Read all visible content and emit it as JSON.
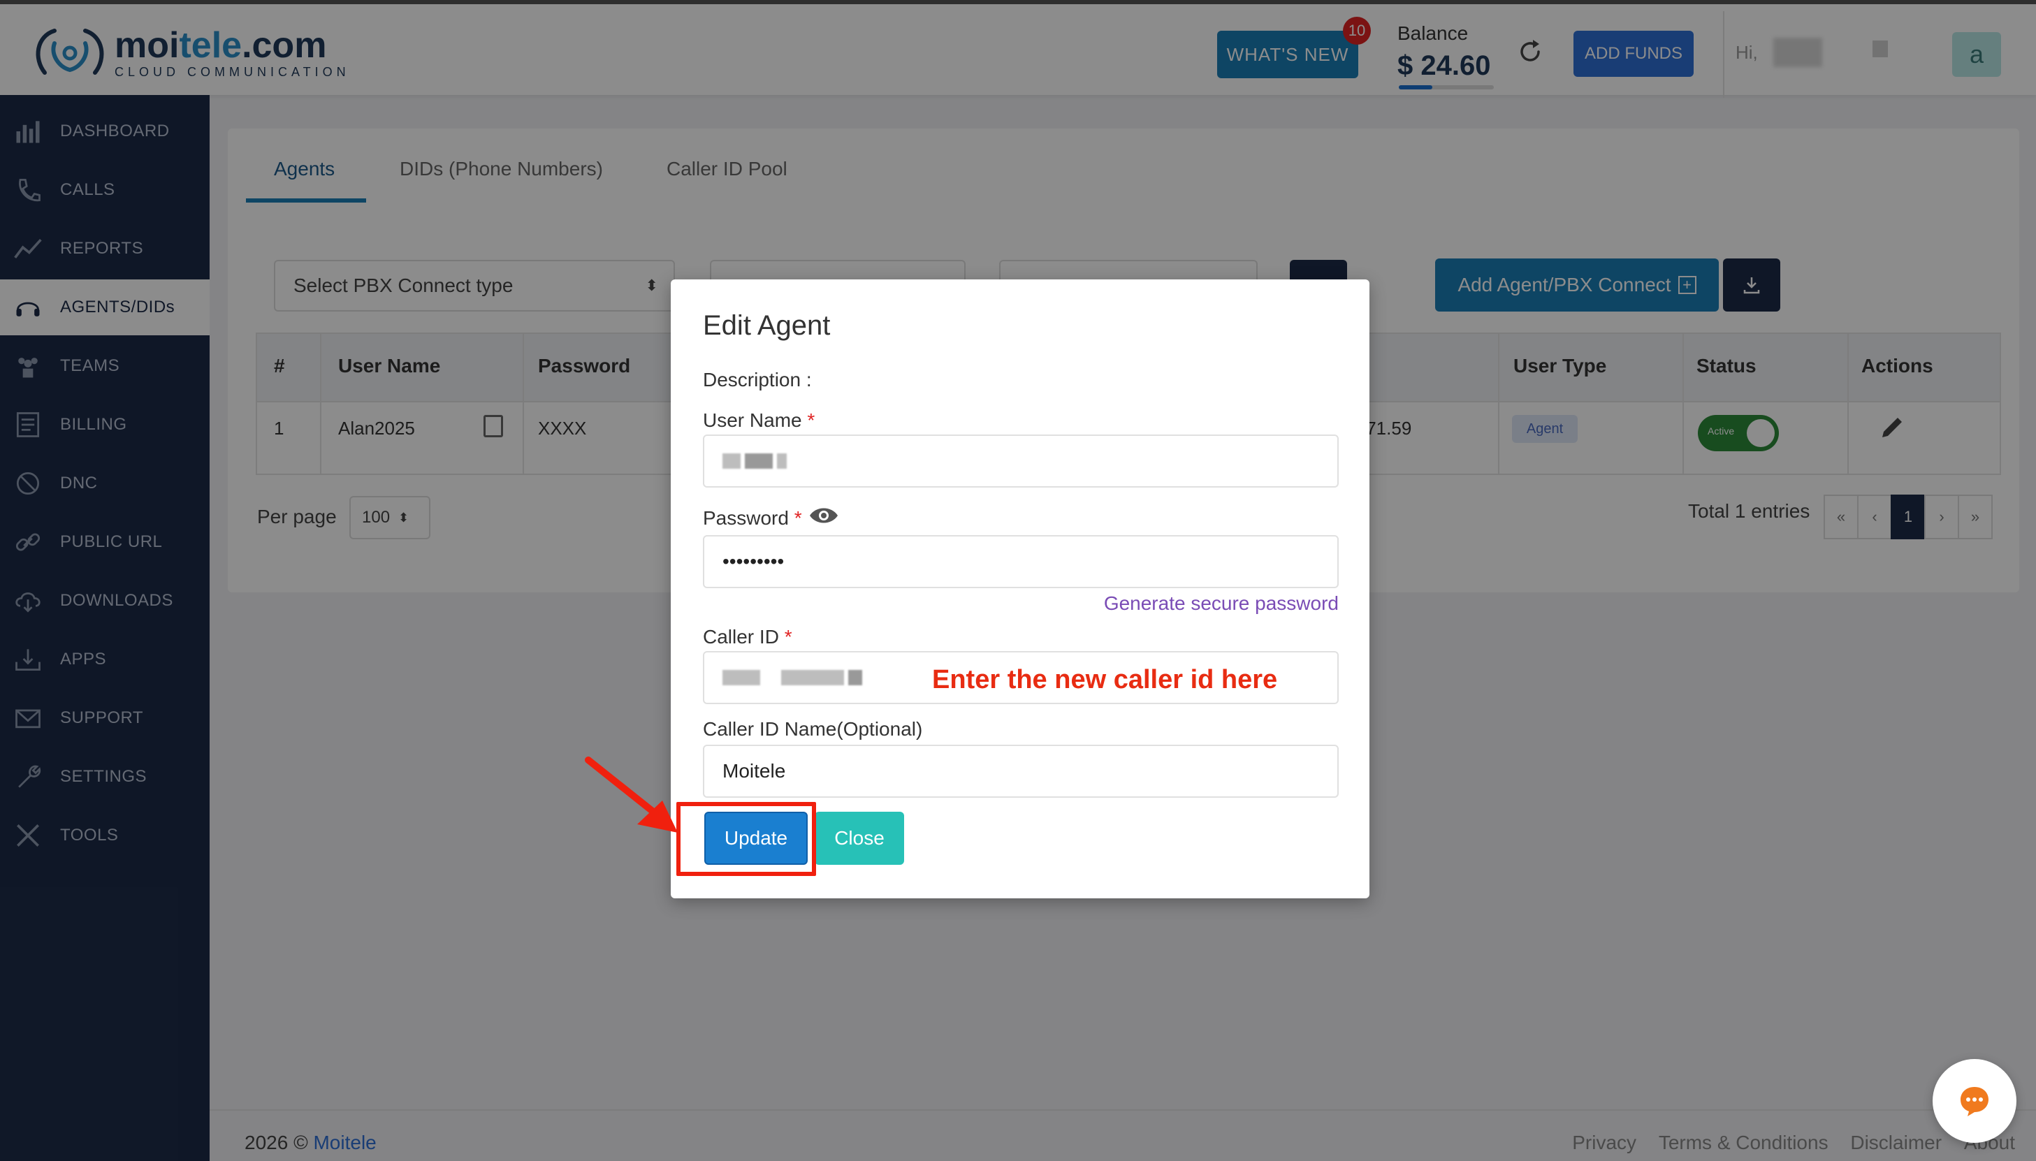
{
  "brand": {
    "name_prefix": "moi",
    "name_accent": "tele",
    "name_suffix": ".com",
    "tagline": "CLOUD COMMUNICATION"
  },
  "header": {
    "whats_new": "WHAT'S NEW",
    "whats_new_count": "10",
    "balance_label": "Balance",
    "balance_value": "$ 24.60",
    "add_funds": "ADD FUNDS",
    "greeting": "Hi,",
    "avatar_letter": "a"
  },
  "sidebar": {
    "items": [
      {
        "label": "DASHBOARD",
        "icon": "chart-bars-icon"
      },
      {
        "label": "CALLS",
        "icon": "phone-icon"
      },
      {
        "label": "REPORTS",
        "icon": "trend-line-icon"
      },
      {
        "label": "AGENTS/DIDs",
        "icon": "headset-icon",
        "active": true
      },
      {
        "label": "TEAMS",
        "icon": "team-icon"
      },
      {
        "label": "BILLING",
        "icon": "invoice-icon"
      },
      {
        "label": "DNC",
        "icon": "ban-icon"
      },
      {
        "label": "PUBLIC URL",
        "icon": "link-icon"
      },
      {
        "label": "DOWNLOADS",
        "icon": "cloud-download-icon"
      },
      {
        "label": "APPS",
        "icon": "tray-download-icon"
      },
      {
        "label": "SUPPORT",
        "icon": "mail-icon"
      },
      {
        "label": "SETTINGS",
        "icon": "wrench-icon"
      },
      {
        "label": "TOOLS",
        "icon": "tools-icon"
      }
    ]
  },
  "tabs": [
    "Agents",
    "DIDs (Phone Numbers)",
    "Caller ID Pool"
  ],
  "filters": {
    "pbx_type_placeholder": "Select PBX Connect type",
    "add_agent": "Add Agent/PBX Connect"
  },
  "table": {
    "headers": [
      "#",
      "User Name",
      "Password",
      "User Type",
      "Status",
      "Actions"
    ],
    "row": {
      "num": "1",
      "username": "Alan2025",
      "password": "XXXX",
      "ip_tail": ".71.59",
      "user_type": "Agent",
      "status": "Active"
    }
  },
  "pagination": {
    "per_page_label": "Per page",
    "per_page_value": "100",
    "total": "Total 1 entries",
    "first": "«",
    "prev": "‹",
    "current": "1",
    "next": "›",
    "last": "»"
  },
  "modal": {
    "title": "Edit Agent",
    "description_label": "Description :",
    "username_label": "User Name",
    "password_label": "Password",
    "password_value": "•••••••••",
    "generate_link": "Generate secure password",
    "caller_id_label": "Caller ID",
    "caller_id_name_label": "Caller ID Name(Optional)",
    "caller_id_name_value": "Moitele",
    "update": "Update",
    "close": "Close",
    "required_mark": "*"
  },
  "annotation": {
    "text": "Enter the new caller id here",
    "color": "#e82c12"
  },
  "footer": {
    "year": "2026 ©",
    "brand_link": "Moitele",
    "links": [
      "Privacy",
      "Terms & Conditions",
      "Disclaimer",
      "About"
    ]
  },
  "colors": {
    "sidebar": "#1d2b48",
    "primary": "#1a7fb6",
    "teal": "#27c1b7",
    "highlight": "#f0200e"
  }
}
